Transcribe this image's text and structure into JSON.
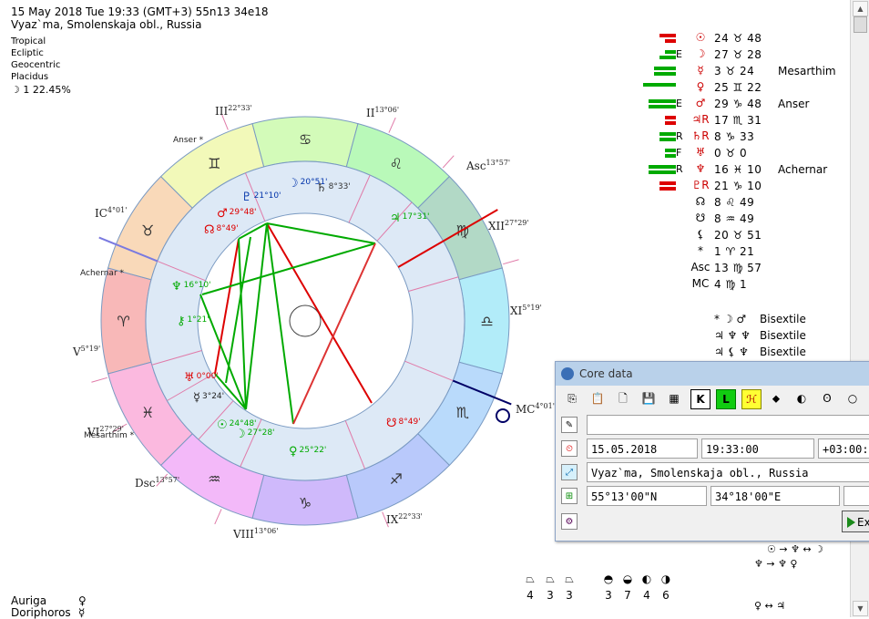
{
  "header": {
    "line1": "15 May 2018  Tue  19:33 (GMT+3) 55n13  34e18",
    "line2": "Vyaz`ma, Smolenskaja obl., Russia",
    "settings": [
      "Tropical",
      "Ecliptic",
      "Geocentric",
      "Placidus"
    ],
    "moon_phase": "☽  1 22.45%"
  },
  "wheel": {
    "signs": [
      "♈",
      "♉",
      "♊",
      "♋",
      "♌",
      "♍",
      "♎",
      "♏",
      "♐",
      "♑",
      "♒",
      "♓"
    ],
    "sign_colors": [
      "#f8b8b8",
      "#f9d9b9",
      "#f2f9b9",
      "#d3fbb9",
      "#b9f9b9",
      "#b2d9c6",
      "#b2ecf9",
      "#b9dafb",
      "#b9c9fb",
      "#cfb9fb",
      "#f3b9f9",
      "#fbb9df"
    ],
    "cusps": [
      {
        "label": "Asc",
        "deg": "13°57'"
      },
      {
        "label": "II",
        "deg": "13°06'"
      },
      {
        "label": "III",
        "deg": "22°33'"
      },
      {
        "label": "IC",
        "deg": "4°01'"
      },
      {
        "label": "V",
        "deg": "5°19'"
      },
      {
        "label": "VI",
        "deg": "27°29'"
      },
      {
        "label": "Dsc",
        "deg": "13°57'"
      },
      {
        "label": "VIII",
        "deg": "13°06'"
      },
      {
        "label": "IX",
        "deg": "22°33'"
      },
      {
        "label": "MC",
        "deg": "4°01'"
      },
      {
        "label": "XI",
        "deg": "5°19'"
      },
      {
        "label": "XII",
        "deg": "27°29'"
      }
    ],
    "stars": [
      "Anser",
      "Achernar",
      "Mesarthim"
    ],
    "planet_labels": [
      {
        "glyph": "☽",
        "deg": "20°51'"
      },
      {
        "glyph": "♄",
        "deg": "8°33'"
      },
      {
        "glyph": "♇",
        "deg": "21°10'"
      },
      {
        "glyph": "♂",
        "deg": "29°48'"
      },
      {
        "glyph": "☊",
        "deg": "8°49'"
      },
      {
        "glyph": "♃",
        "deg": "17°31'"
      },
      {
        "glyph": "♆",
        "deg": "16°10'"
      },
      {
        "glyph": "⚷",
        "deg": "1°21'"
      },
      {
        "glyph": "♅",
        "deg": "0°00'"
      },
      {
        "glyph": "☿",
        "deg": "3°24'"
      },
      {
        "glyph": "☉",
        "deg": "24°48'"
      },
      {
        "glyph": "☽",
        "deg": "27°28'"
      },
      {
        "glyph": "♀",
        "deg": "25°22'"
      },
      {
        "glyph": "☋",
        "deg": "8°49'"
      }
    ]
  },
  "planet_list": [
    {
      "bars": [
        3,
        2
      ],
      "color": "#d00",
      "flag": "",
      "glyph": "☉",
      "pos": "24 ♉ 48",
      "star": ""
    },
    {
      "bars": [
        2,
        3
      ],
      "color": "#0a0",
      "flag": "E",
      "glyph": "☽",
      "pos": "27 ♉ 28",
      "star": ""
    },
    {
      "bars": [
        4,
        4
      ],
      "color": "#0a0",
      "flag": "",
      "glyph": "☿",
      "pos": "3 ♉ 24",
      "star": "Mesarthim"
    },
    {
      "bars": [
        6,
        0
      ],
      "color": "#0a0",
      "flag": "",
      "glyph": "♀",
      "pos": "25 ♊ 22",
      "star": ""
    },
    {
      "bars": [
        5,
        5
      ],
      "color": "#0a0",
      "flag": "E",
      "glyph": "♂",
      "pos": "29 ♑ 48",
      "star": "Anser"
    },
    {
      "bars": [
        2,
        2
      ],
      "color": "#d00",
      "flag": "",
      "glyph": "♃R",
      "pos": "17 ♏ 31",
      "star": ""
    },
    {
      "bars": [
        3,
        3
      ],
      "color": "#0a0",
      "flag": "R",
      "glyph": "♄R",
      "pos": "8 ♑ 33",
      "star": ""
    },
    {
      "bars": [
        2,
        2
      ],
      "color": "#0a0",
      "flag": "F",
      "glyph": "♅",
      "pos": "0 ♉ 0",
      "star": ""
    },
    {
      "bars": [
        5,
        5
      ],
      "color": "#0a0",
      "flag": "R",
      "glyph": "♆",
      "pos": "16 ♓ 10",
      "star": "Achernar"
    },
    {
      "bars": [
        3,
        3
      ],
      "color": "#d00",
      "flag": "",
      "glyph": "♇R",
      "pos": "21 ♑ 10",
      "star": ""
    },
    {
      "bars": [
        0,
        0
      ],
      "color": "#000",
      "flag": "",
      "glyph": "☊",
      "pos": "8 ♌ 49",
      "star": ""
    },
    {
      "bars": [
        0,
        0
      ],
      "color": "#000",
      "flag": "",
      "glyph": "☋",
      "pos": "8 ♒ 49",
      "star": ""
    },
    {
      "bars": [
        0,
        0
      ],
      "color": "#000",
      "flag": "",
      "glyph": "⚸",
      "pos": "20 ♉ 51",
      "star": ""
    },
    {
      "bars": [
        0,
        0
      ],
      "color": "#000",
      "flag": "",
      "glyph": "*",
      "pos": "1 ♈ 21",
      "star": ""
    },
    {
      "bars": [
        0,
        0
      ],
      "color": "#000",
      "flag": "",
      "glyph": "Asc",
      "pos": "13 ♍ 57",
      "star": ""
    },
    {
      "bars": [
        0,
        0
      ],
      "color": "#000",
      "flag": "",
      "glyph": "MC",
      "pos": "4 ♍ 1",
      "star": ""
    }
  ],
  "aspect_patterns": [
    {
      "glyphs": "* ☽ ♂",
      "name": "Bisextile"
    },
    {
      "glyphs": "♃ ♆ ♆",
      "name": "Bisextile"
    },
    {
      "glyphs": "♃ ⚸ ♆",
      "name": "Bisextile"
    }
  ],
  "core_dialog": {
    "title": "Core data",
    "toolbar": [
      "⎘",
      "📋",
      "🗋",
      "💾",
      "▦",
      "K",
      "L",
      "ℋ",
      "⬥",
      "◐",
      "ʘ",
      "○",
      "○"
    ],
    "name_value": "",
    "date": "15.05.2018",
    "time": "19:33:00",
    "tz": "+03:00:",
    "place": "Vyaz`ma, Smolenskaja obl., Russia",
    "lat": "55°13'00\"N",
    "lon": "34°18'00\"E",
    "exec_label": "Ex"
  },
  "bottom_stars": [
    {
      "name": "Auriga",
      "glyph": "♀"
    },
    {
      "name": "Doriphoros",
      "glyph": "☿"
    }
  ],
  "element_counts": [
    "4",
    "3",
    "3",
    "3",
    "7",
    "4",
    "6"
  ],
  "relations": [
    "☉ → ♆ ↔ ☽",
    "♆ → ♆ ♀",
    "♀ ↔ ♃"
  ]
}
